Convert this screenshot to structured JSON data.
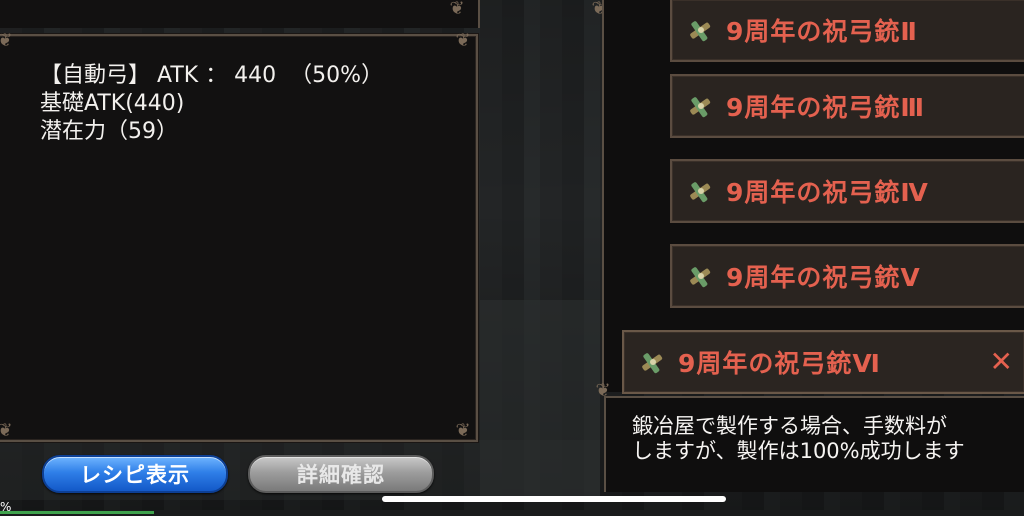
{
  "stats": {
    "line1": "【自動弓】 ATK ： 440  （50%）",
    "line2": "基礎ATK(440)",
    "line3": "潜在力（59）"
  },
  "list": {
    "items": [
      {
        "label": "9周年の祝弓銃Ⅱ",
        "icon": "crossbow-icon"
      },
      {
        "label": "9周年の祝弓銃Ⅲ",
        "icon": "crossbow-icon"
      },
      {
        "label": "9周年の祝弓銃Ⅳ",
        "icon": "crossbow-icon"
      },
      {
        "label": "9周年の祝弓銃Ⅴ",
        "icon": "crossbow-icon"
      },
      {
        "label": "9周年の祝弓銃Ⅵ",
        "icon": "crossbow-icon",
        "selected": true
      }
    ],
    "close_glyph": "✕"
  },
  "description": {
    "line1": "鍛冶屋で製作する場合、手数料が",
    "line2": "しますが、製作は100%成功します"
  },
  "buttons": {
    "recipe": "レシピ表示",
    "detail": "詳細確認"
  },
  "status": {
    "percent_glyph": "%",
    "progress": 0.15
  },
  "colors": {
    "item_text": "#e4614f",
    "recipe_button": "#2f7fe8",
    "detail_button": "#9d9d9d"
  }
}
